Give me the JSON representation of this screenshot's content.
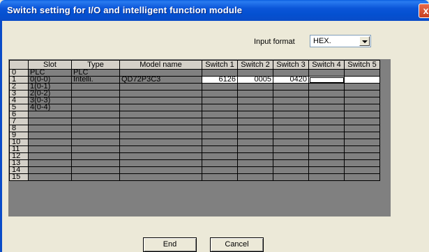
{
  "window": {
    "title": "Switch setting for I/O and intelligent function module",
    "close_glyph": "x"
  },
  "input_format": {
    "label": "Input format",
    "value": "HEX."
  },
  "grid": {
    "columns": [
      "",
      "Slot",
      "Type",
      "Model name",
      "Switch 1",
      "Switch 2",
      "Switch 3",
      "Switch 4",
      "Switch 5"
    ],
    "rows": [
      {
        "num": "0",
        "slot": "PLC",
        "type": "PLC",
        "model": "",
        "s1": "",
        "s2": "",
        "s3": "",
        "s4": "",
        "s5": ""
      },
      {
        "num": "1",
        "slot": "0(0-0)",
        "type": "Intelli.",
        "model": "QD72P3C3",
        "s1": "6126",
        "s2": "0005",
        "s3": "0420",
        "s4": "",
        "s5": ""
      },
      {
        "num": "2",
        "slot": "1(0-1)",
        "type": "",
        "model": "",
        "s1": "",
        "s2": "",
        "s3": "",
        "s4": "",
        "s5": ""
      },
      {
        "num": "3",
        "slot": "2(0-2)",
        "type": "",
        "model": "",
        "s1": "",
        "s2": "",
        "s3": "",
        "s4": "",
        "s5": ""
      },
      {
        "num": "4",
        "slot": "3(0-3)",
        "type": "",
        "model": "",
        "s1": "",
        "s2": "",
        "s3": "",
        "s4": "",
        "s5": ""
      },
      {
        "num": "5",
        "slot": "4(0-4)",
        "type": "",
        "model": "",
        "s1": "",
        "s2": "",
        "s3": "",
        "s4": "",
        "s5": ""
      },
      {
        "num": "6",
        "slot": "",
        "type": "",
        "model": "",
        "s1": "",
        "s2": "",
        "s3": "",
        "s4": "",
        "s5": ""
      },
      {
        "num": "7",
        "slot": "",
        "type": "",
        "model": "",
        "s1": "",
        "s2": "",
        "s3": "",
        "s4": "",
        "s5": ""
      },
      {
        "num": "8",
        "slot": "",
        "type": "",
        "model": "",
        "s1": "",
        "s2": "",
        "s3": "",
        "s4": "",
        "s5": ""
      },
      {
        "num": "9",
        "slot": "",
        "type": "",
        "model": "",
        "s1": "",
        "s2": "",
        "s3": "",
        "s4": "",
        "s5": ""
      },
      {
        "num": "10",
        "slot": "",
        "type": "",
        "model": "",
        "s1": "",
        "s2": "",
        "s3": "",
        "s4": "",
        "s5": ""
      },
      {
        "num": "11",
        "slot": "",
        "type": "",
        "model": "",
        "s1": "",
        "s2": "",
        "s3": "",
        "s4": "",
        "s5": ""
      },
      {
        "num": "12",
        "slot": "",
        "type": "",
        "model": "",
        "s1": "",
        "s2": "",
        "s3": "",
        "s4": "",
        "s5": ""
      },
      {
        "num": "13",
        "slot": "",
        "type": "",
        "model": "",
        "s1": "",
        "s2": "",
        "s3": "",
        "s4": "",
        "s5": ""
      },
      {
        "num": "14",
        "slot": "",
        "type": "",
        "model": "",
        "s1": "",
        "s2": "",
        "s3": "",
        "s4": "",
        "s5": ""
      },
      {
        "num": "15",
        "slot": "",
        "type": "",
        "model": "",
        "s1": "",
        "s2": "",
        "s3": "",
        "s4": "",
        "s5": ""
      }
    ]
  },
  "buttons": {
    "end": "End",
    "cancel": "Cancel"
  },
  "colors": {
    "titlebar": "#0a55d8",
    "grid_cell": "#808080",
    "edit_cell": "#ffffff"
  }
}
